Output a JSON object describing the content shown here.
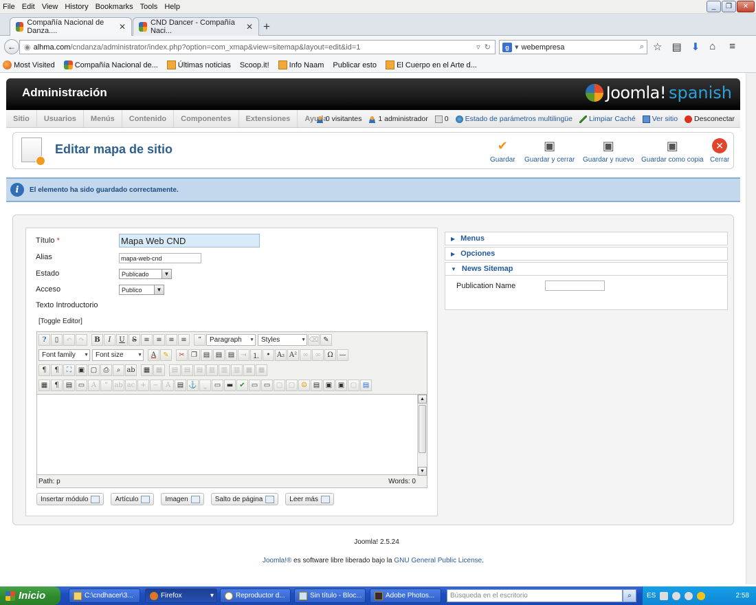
{
  "browser": {
    "menu": [
      "File",
      "Edit",
      "View",
      "History",
      "Bookmarks",
      "Tools",
      "Help"
    ],
    "tabs": [
      {
        "label": "Compañía Nacional de Danza....",
        "active": true
      },
      {
        "label": "CND Dancer - Compañía Naci...",
        "active": false
      }
    ],
    "url_host": "alhma.com",
    "url_path": "/cndanza/administrator/index.php?option=com_xmap&view=sitemap&layout=edit&id=1",
    "search_value": "webempresa",
    "bookmarks": [
      "Most Visited",
      "Compañía Nacional de...",
      "Últimas noticias",
      "Scoop.it!",
      "Info Naam",
      "Publicar esto",
      "El Cuerpo en el Arte d..."
    ]
  },
  "admin": {
    "title": "Administración",
    "logo_word": "Joomla!",
    "logo_lang": "spanish",
    "menu": [
      "Sitio",
      "Usuarios",
      "Menús",
      "Contenido",
      "Componentes",
      "Extensiones",
      "Ayuda"
    ],
    "status": {
      "visitors": "0 visitantes",
      "admins": "1 administrador",
      "messages": "0",
      "multilang": "Estado de parámetros multilingüe",
      "clear_cache": "Limpiar Caché",
      "view_site": "Ver sitio",
      "logout": "Desconectar"
    }
  },
  "toolbar": {
    "page_title": "Editar mapa de sitio",
    "save": "Guardar",
    "save_close": "Guardar y cerrar",
    "save_new": "Guardar y nuevo",
    "save_copy": "Guardar como copia",
    "close": "Cerrar"
  },
  "message": "El elemento ha sido guardado correctamente.",
  "form": {
    "title_label": "Título",
    "title_required": "*",
    "title_value": "Mapa Web CND",
    "alias_label": "Alias",
    "alias_value": "mapa-web-cnd",
    "state_label": "Estado",
    "state_value": "Publicado",
    "access_label": "Acceso",
    "access_value": "Publico",
    "intro_label": "Texto Introductorio",
    "toggle_editor": "[Toggle Editor]"
  },
  "editor": {
    "format_select": "Paragraph",
    "styles_select": "Styles",
    "font_family": "Font family",
    "font_size": "Font size",
    "path_label": "Path:",
    "path_value": "p",
    "words": "Words: 0"
  },
  "editor_buttons": [
    "Insertar módulo",
    "Artículo",
    "Imagen",
    "Salto de página",
    "Leer más"
  ],
  "sidepanel": {
    "menus": "Menus",
    "options": "Opciones",
    "news_sitemap": "News Sitemap",
    "publication_name_label": "Publication Name"
  },
  "footer": {
    "version": "Joomla! 2.5.24",
    "joomla_link": "Joomla!®",
    "license_text": " es software libre liberado bajo la ",
    "license_link": "GNU General Public License",
    "period": "."
  },
  "taskbar": {
    "start": "Inicio",
    "items": [
      "C:\\cndhacer\\3...",
      "Firefox",
      "Reproductor d...",
      "Sin título - Bloc...",
      "Adobe Photos..."
    ],
    "search_placeholder": "Búsqueda en el escritorio",
    "lang": "ES",
    "clock": "2:58"
  }
}
